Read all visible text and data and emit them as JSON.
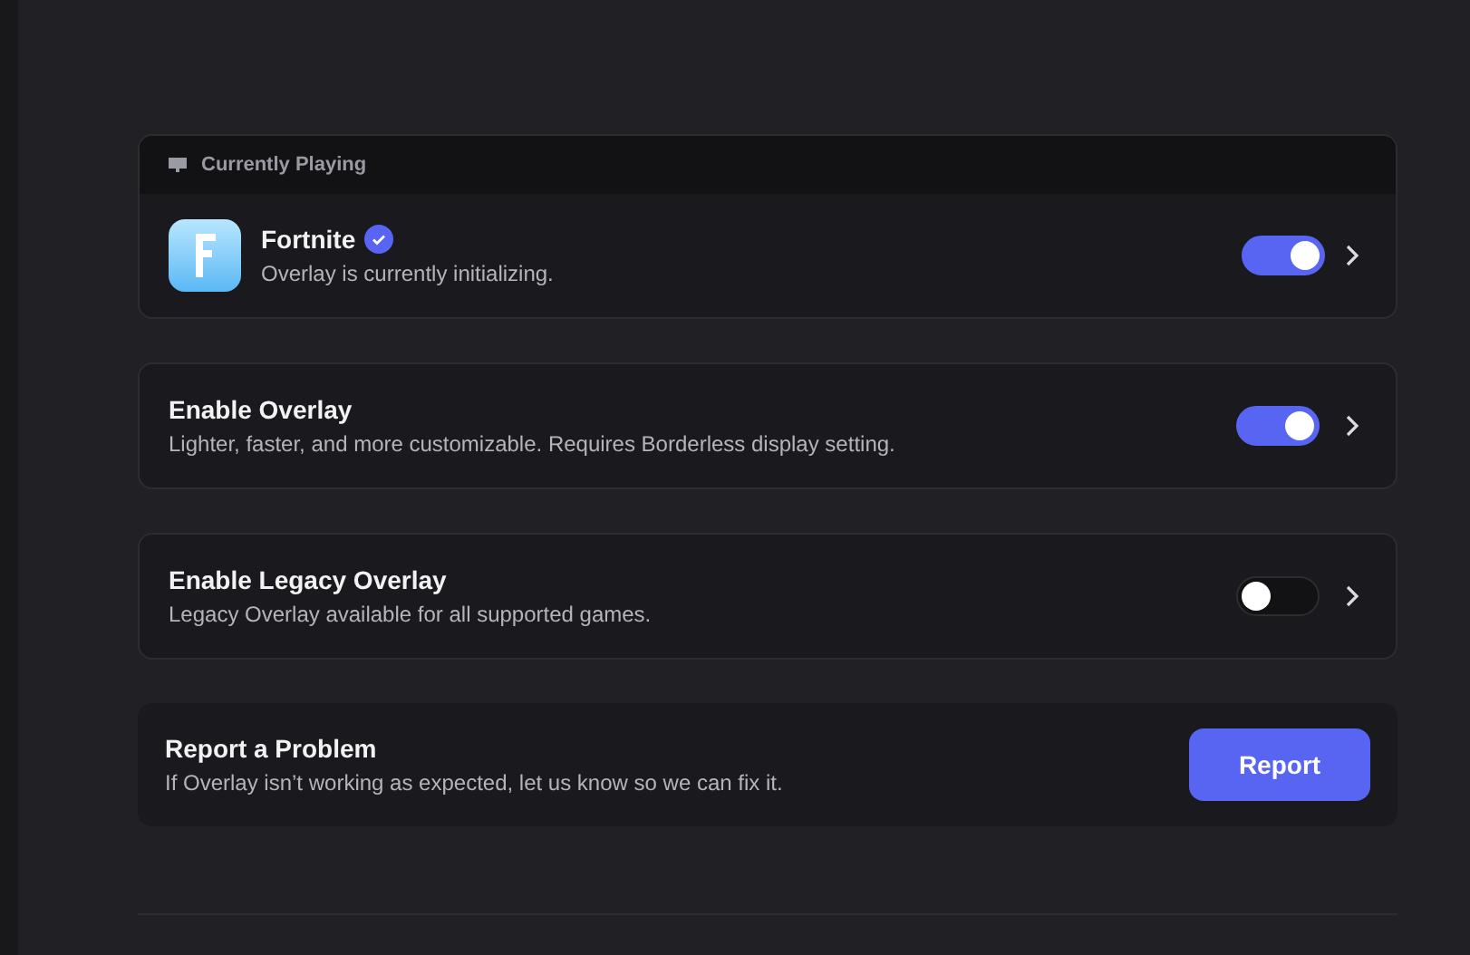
{
  "now_playing": {
    "header": "Currently Playing",
    "game": {
      "title": "Fortnite",
      "verified": true,
      "status": "Overlay is currently initializing.",
      "on": true
    }
  },
  "settings": [
    {
      "title": "Enable Overlay",
      "description": "Lighter, faster, and more customizable. Requires Borderless display setting.",
      "on": true
    },
    {
      "title": "Enable Legacy Overlay",
      "description": "Legacy Overlay available for all supported games.",
      "on": false
    }
  ],
  "report": {
    "title": "Report a Problem",
    "description": "If Overlay isn’t working as expected, let us know so we can fix it.",
    "button": "Report"
  }
}
